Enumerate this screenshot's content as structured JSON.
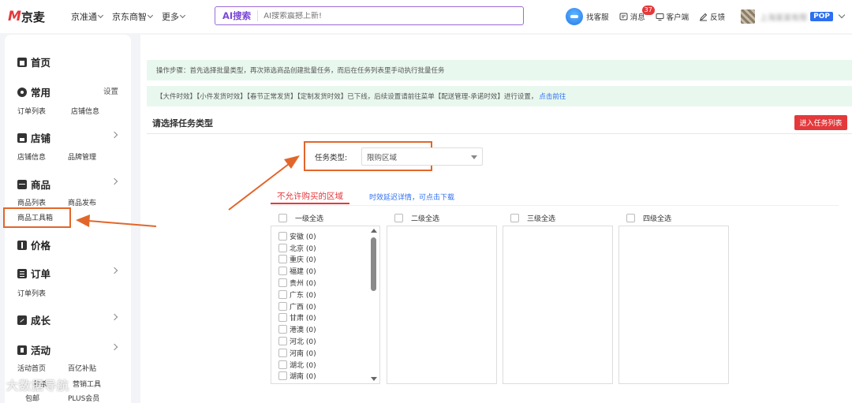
{
  "header": {
    "logo_m": "M",
    "logo_text": "京麦",
    "nav": [
      "京准通",
      "京东商智",
      "更多"
    ],
    "search": {
      "tag": "AI搜索",
      "placeholder": "AI搜索震撼上新!"
    },
    "tools": {
      "service": "找客服",
      "message": "消息",
      "message_badge": "37",
      "client": "客户端",
      "feedback": "反馈"
    },
    "user_name": "上海某某有限",
    "user_tag": "POP"
  },
  "sidebar": {
    "home": "首页",
    "common": {
      "title": "常用",
      "setting": "设置",
      "items": [
        "订单列表",
        "店铺信息"
      ]
    },
    "store": {
      "title": "店铺",
      "items": [
        "店铺信息",
        "品牌管理"
      ]
    },
    "goods": {
      "title": "商品",
      "items": [
        "商品列表",
        "商品发布",
        "商品工具箱"
      ]
    },
    "price": {
      "title": "价格"
    },
    "order": {
      "title": "订单",
      "items": [
        "订单列表"
      ]
    },
    "growth": {
      "title": "成长"
    },
    "activity": {
      "title": "活动",
      "items": [
        "活动首页",
        "百亿补贴",
        "秒杀",
        "营销工具",
        "包邮",
        "PLUS会员"
      ]
    }
  },
  "main": {
    "notice1": "操作步骤：首先选择批量类型，再次筛选商品创建批量任务，而后在任务列表里手动执行批量任务",
    "notice2": "【大件时效】【小件发货时效】【春节正常发货】【定制发货时效】已下线，后续设置请前往菜单【配送管理-承诺时效】进行设置，",
    "notice2_link": "点击前往",
    "section_title": "请选择任务类型",
    "enter_button": "进入任务列表",
    "type_label": "任务类型:",
    "type_value": "限购区域",
    "tab_active": "不允许购买的区域",
    "tab_link": "时效延迟详情，可点击下载",
    "levels": [
      "一级全选",
      "二级全选",
      "三级全选",
      "四级全选"
    ],
    "regions": [
      "安徽 (0)",
      "北京 (0)",
      "重庆 (0)",
      "福建 (0)",
      "贵州 (0)",
      "广东 (0)",
      "广西 (0)",
      "甘肃 (0)",
      "港澳 (0)",
      "河北 (0)",
      "河南 (0)",
      "湖北 (0)",
      "湖南 (0)"
    ]
  },
  "watermark": "大数据导航",
  "colors": {
    "brand_red": "#e4393c",
    "annotation": "#e2662a",
    "link": "#2e6ff0",
    "notice_bg": "#e9f8ef"
  }
}
